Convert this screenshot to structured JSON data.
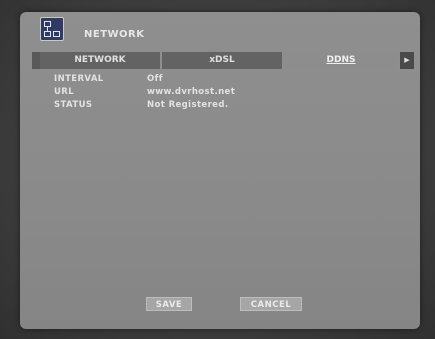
{
  "window": {
    "title": "NETWORK"
  },
  "icons": {
    "header": "network-icon",
    "scroll": "arrow-right-icon"
  },
  "tabs": [
    {
      "label": "NETWORK"
    },
    {
      "label": "xDSL"
    },
    {
      "label": "DDNS",
      "selected": true
    }
  ],
  "tab_scroll_glyph": "▶",
  "fields": [
    {
      "label": "INTERVAL",
      "value": "Off"
    },
    {
      "label": "URL",
      "value": "www.dvrhost.net"
    },
    {
      "label": "STATUS",
      "value": "Not Registered."
    }
  ],
  "buttons": {
    "save": "SAVE",
    "cancel": "CANCEL"
  },
  "colors": {
    "panel": "#8a8a8a",
    "active_tab": "#8d8d8d",
    "inactive_tab": "#636363",
    "text": "#e2e2e2"
  }
}
